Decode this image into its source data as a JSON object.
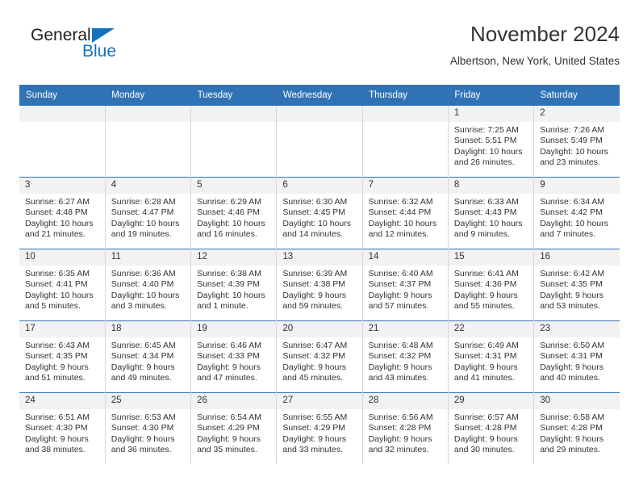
{
  "brand": {
    "name_part1": "General",
    "name_part2": "Blue",
    "triangle_color": "#1472bd",
    "accent_color": "#3073b5"
  },
  "header": {
    "title": "November 2024",
    "subtitle": "Albertson, New York, United States"
  },
  "weekday_headers": [
    "Sunday",
    "Monday",
    "Tuesday",
    "Wednesday",
    "Thursday",
    "Friday",
    "Saturday"
  ],
  "labels": {
    "sunrise": "Sunrise:",
    "sunset": "Sunset:",
    "daylight": "Daylight:"
  },
  "weeks": [
    [
      {
        "day": "",
        "sunrise": "",
        "sunset": "",
        "daylight": "",
        "empty": true
      },
      {
        "day": "",
        "sunrise": "",
        "sunset": "",
        "daylight": "",
        "empty": true
      },
      {
        "day": "",
        "sunrise": "",
        "sunset": "",
        "daylight": "",
        "empty": true
      },
      {
        "day": "",
        "sunrise": "",
        "sunset": "",
        "daylight": "",
        "empty": true
      },
      {
        "day": "",
        "sunrise": "",
        "sunset": "",
        "daylight": "",
        "empty": true
      },
      {
        "day": "1",
        "sunrise": "Sunrise: 7:25 AM",
        "sunset": "Sunset: 5:51 PM",
        "daylight": "Daylight: 10 hours and 26 minutes."
      },
      {
        "day": "2",
        "sunrise": "Sunrise: 7:26 AM",
        "sunset": "Sunset: 5:49 PM",
        "daylight": "Daylight: 10 hours and 23 minutes."
      }
    ],
    [
      {
        "day": "3",
        "sunrise": "Sunrise: 6:27 AM",
        "sunset": "Sunset: 4:48 PM",
        "daylight": "Daylight: 10 hours and 21 minutes."
      },
      {
        "day": "4",
        "sunrise": "Sunrise: 6:28 AM",
        "sunset": "Sunset: 4:47 PM",
        "daylight": "Daylight: 10 hours and 19 minutes."
      },
      {
        "day": "5",
        "sunrise": "Sunrise: 6:29 AM",
        "sunset": "Sunset: 4:46 PM",
        "daylight": "Daylight: 10 hours and 16 minutes."
      },
      {
        "day": "6",
        "sunrise": "Sunrise: 6:30 AM",
        "sunset": "Sunset: 4:45 PM",
        "daylight": "Daylight: 10 hours and 14 minutes."
      },
      {
        "day": "7",
        "sunrise": "Sunrise: 6:32 AM",
        "sunset": "Sunset: 4:44 PM",
        "daylight": "Daylight: 10 hours and 12 minutes."
      },
      {
        "day": "8",
        "sunrise": "Sunrise: 6:33 AM",
        "sunset": "Sunset: 4:43 PM",
        "daylight": "Daylight: 10 hours and 9 minutes."
      },
      {
        "day": "9",
        "sunrise": "Sunrise: 6:34 AM",
        "sunset": "Sunset: 4:42 PM",
        "daylight": "Daylight: 10 hours and 7 minutes."
      }
    ],
    [
      {
        "day": "10",
        "sunrise": "Sunrise: 6:35 AM",
        "sunset": "Sunset: 4:41 PM",
        "daylight": "Daylight: 10 hours and 5 minutes."
      },
      {
        "day": "11",
        "sunrise": "Sunrise: 6:36 AM",
        "sunset": "Sunset: 4:40 PM",
        "daylight": "Daylight: 10 hours and 3 minutes."
      },
      {
        "day": "12",
        "sunrise": "Sunrise: 6:38 AM",
        "sunset": "Sunset: 4:39 PM",
        "daylight": "Daylight: 10 hours and 1 minute."
      },
      {
        "day": "13",
        "sunrise": "Sunrise: 6:39 AM",
        "sunset": "Sunset: 4:38 PM",
        "daylight": "Daylight: 9 hours and 59 minutes."
      },
      {
        "day": "14",
        "sunrise": "Sunrise: 6:40 AM",
        "sunset": "Sunset: 4:37 PM",
        "daylight": "Daylight: 9 hours and 57 minutes."
      },
      {
        "day": "15",
        "sunrise": "Sunrise: 6:41 AM",
        "sunset": "Sunset: 4:36 PM",
        "daylight": "Daylight: 9 hours and 55 minutes."
      },
      {
        "day": "16",
        "sunrise": "Sunrise: 6:42 AM",
        "sunset": "Sunset: 4:35 PM",
        "daylight": "Daylight: 9 hours and 53 minutes."
      }
    ],
    [
      {
        "day": "17",
        "sunrise": "Sunrise: 6:43 AM",
        "sunset": "Sunset: 4:35 PM",
        "daylight": "Daylight: 9 hours and 51 minutes."
      },
      {
        "day": "18",
        "sunrise": "Sunrise: 6:45 AM",
        "sunset": "Sunset: 4:34 PM",
        "daylight": "Daylight: 9 hours and 49 minutes."
      },
      {
        "day": "19",
        "sunrise": "Sunrise: 6:46 AM",
        "sunset": "Sunset: 4:33 PM",
        "daylight": "Daylight: 9 hours and 47 minutes."
      },
      {
        "day": "20",
        "sunrise": "Sunrise: 6:47 AM",
        "sunset": "Sunset: 4:32 PM",
        "daylight": "Daylight: 9 hours and 45 minutes."
      },
      {
        "day": "21",
        "sunrise": "Sunrise: 6:48 AM",
        "sunset": "Sunset: 4:32 PM",
        "daylight": "Daylight: 9 hours and 43 minutes."
      },
      {
        "day": "22",
        "sunrise": "Sunrise: 6:49 AM",
        "sunset": "Sunset: 4:31 PM",
        "daylight": "Daylight: 9 hours and 41 minutes."
      },
      {
        "day": "23",
        "sunrise": "Sunrise: 6:50 AM",
        "sunset": "Sunset: 4:31 PM",
        "daylight": "Daylight: 9 hours and 40 minutes."
      }
    ],
    [
      {
        "day": "24",
        "sunrise": "Sunrise: 6:51 AM",
        "sunset": "Sunset: 4:30 PM",
        "daylight": "Daylight: 9 hours and 38 minutes."
      },
      {
        "day": "25",
        "sunrise": "Sunrise: 6:53 AM",
        "sunset": "Sunset: 4:30 PM",
        "daylight": "Daylight: 9 hours and 36 minutes."
      },
      {
        "day": "26",
        "sunrise": "Sunrise: 6:54 AM",
        "sunset": "Sunset: 4:29 PM",
        "daylight": "Daylight: 9 hours and 35 minutes."
      },
      {
        "day": "27",
        "sunrise": "Sunrise: 6:55 AM",
        "sunset": "Sunset: 4:29 PM",
        "daylight": "Daylight: 9 hours and 33 minutes."
      },
      {
        "day": "28",
        "sunrise": "Sunrise: 6:56 AM",
        "sunset": "Sunset: 4:28 PM",
        "daylight": "Daylight: 9 hours and 32 minutes."
      },
      {
        "day": "29",
        "sunrise": "Sunrise: 6:57 AM",
        "sunset": "Sunset: 4:28 PM",
        "daylight": "Daylight: 9 hours and 30 minutes."
      },
      {
        "day": "30",
        "sunrise": "Sunrise: 6:58 AM",
        "sunset": "Sunset: 4:28 PM",
        "daylight": "Daylight: 9 hours and 29 minutes."
      }
    ]
  ]
}
